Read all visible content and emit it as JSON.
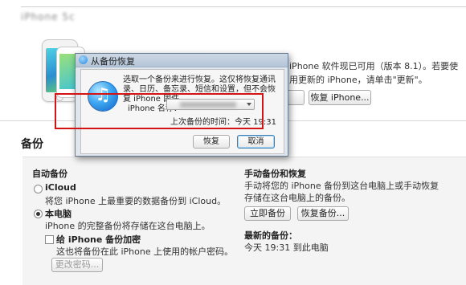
{
  "device": {
    "title": "iPhone 5c",
    "software_info": "iPhone 软件现已可用（版本 8.1）。若要使用更新的 iPhone，请单击\"更新\"。",
    "restore_iphone_label": "恢复 iPhone..."
  },
  "backup": {
    "heading": "备份",
    "auto": {
      "heading": "自动备份",
      "icloud_label": "iCloud",
      "icloud_desc": "将您 iPhone 上最重要的数据备份到 iCloud。",
      "thispc_label": "本电脑",
      "thispc_desc": "iPhone 的完整备份将存储在这台电脑上。",
      "encrypt_label": "给 iPhone 备份加密",
      "encrypt_desc": "这也将备份在此 iPhone 上使用的帐户密码。",
      "change_password_label": "更改密码...",
      "selected": "本电脑",
      "encrypt_checked": false
    },
    "manual": {
      "heading": "手动备份和恢复",
      "desc": "手动将您的 iPhone 备份到这台电脑上或手动恢复存储在这台电脑上的备份。",
      "backup_now_label": "立即备份",
      "restore_backup_label": "恢复备份...",
      "latest_heading": "最新的备份：",
      "latest_value": "今天 19:31 到此电脑"
    }
  },
  "dialog": {
    "title": "从备份恢复",
    "message": "选取一个备份来进行恢复。这仅将恢复通讯录、日历、备忘录、短信和设置，但不会恢复 iPhone 固件。",
    "name_label": "iPhone 名称：",
    "last_backup": "上次备份的时间：今天 19:31",
    "restore_label": "恢复",
    "cancel_label": "取消"
  },
  "colors": {
    "highlight_box": "#d41414",
    "dialog_frame": "#dfe6ee"
  }
}
